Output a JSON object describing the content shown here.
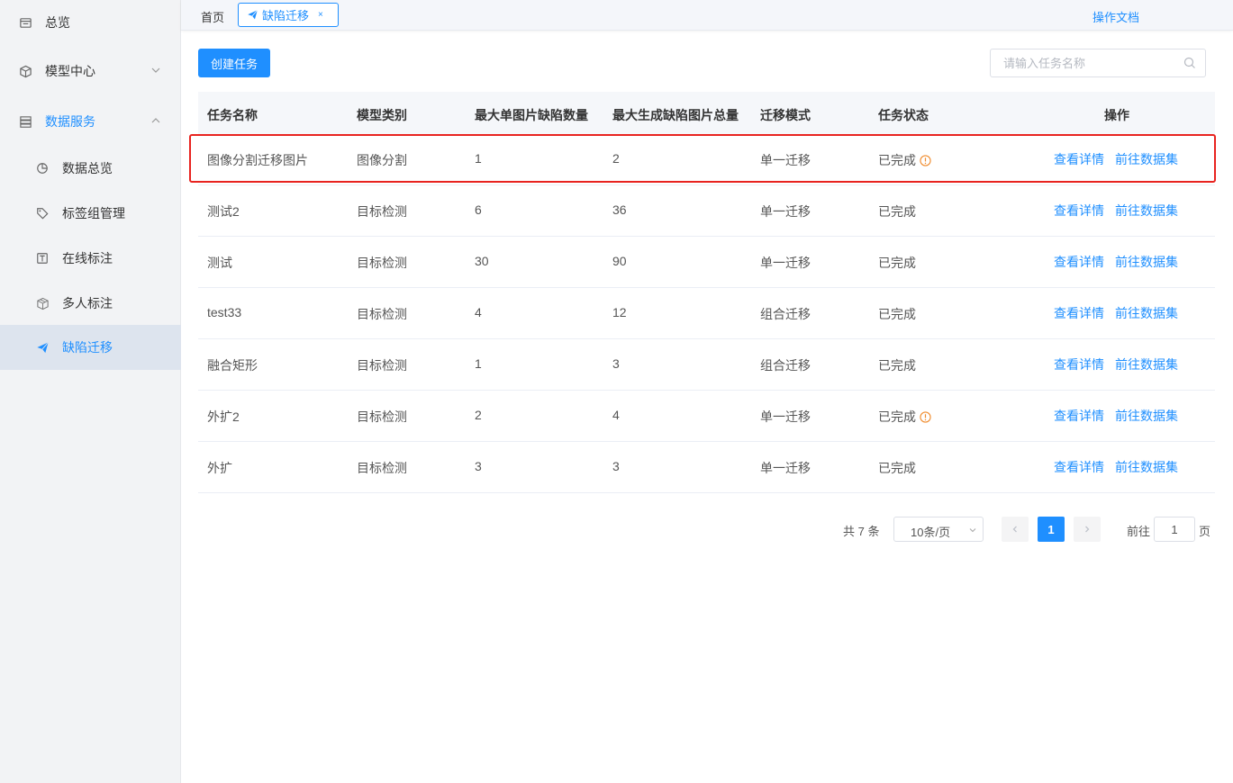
{
  "sidebar": {
    "items": [
      {
        "label": "总览",
        "icon": "overview-icon"
      },
      {
        "label": "模型中心",
        "icon": "cube-icon"
      },
      {
        "label": "数据服务",
        "icon": "storage-icon"
      }
    ],
    "sub_items": [
      {
        "label": "数据总览",
        "icon": "pie-chart-icon"
      },
      {
        "label": "标签组管理",
        "icon": "tag-icon"
      },
      {
        "label": "在线标注",
        "icon": "text-box-icon"
      },
      {
        "label": "多人标注",
        "icon": "boxes-icon"
      },
      {
        "label": "缺陷迁移",
        "icon": "paper-plane-icon"
      }
    ]
  },
  "topbar": {
    "home_tab": "首页",
    "active_tab": "缺陷迁移",
    "close_glyph": "×",
    "doc_link": "操作文档"
  },
  "toolbar": {
    "create_label": "创建任务",
    "search_placeholder": "请输入任务名称"
  },
  "table": {
    "headers": [
      "任务名称",
      "模型类别",
      "最大单图片缺陷数量",
      "最大生成缺陷图片总量",
      "迁移模式",
      "任务状态",
      "操作"
    ],
    "action_view": "查看详情",
    "action_dataset": "前往数据集",
    "rows": [
      {
        "name": "图像分割迁移图片",
        "type": "图像分割",
        "max_single": "1",
        "max_total": "2",
        "mode": "单一迁移",
        "status": "已完成",
        "warning": true
      },
      {
        "name": "测试2",
        "type": "目标检测",
        "max_single": "6",
        "max_total": "36",
        "mode": "单一迁移",
        "status": "已完成",
        "warning": false
      },
      {
        "name": "测试",
        "type": "目标检测",
        "max_single": "30",
        "max_total": "90",
        "mode": "单一迁移",
        "status": "已完成",
        "warning": false
      },
      {
        "name": "test33",
        "type": "目标检测",
        "max_single": "4",
        "max_total": "12",
        "mode": "组合迁移",
        "status": "已完成",
        "warning": false
      },
      {
        "name": "融合矩形",
        "type": "目标检测",
        "max_single": "1",
        "max_total": "3",
        "mode": "组合迁移",
        "status": "已完成",
        "warning": false
      },
      {
        "name": "外扩2",
        "type": "目标检测",
        "max_single": "2",
        "max_total": "4",
        "mode": "单一迁移",
        "status": "已完成",
        "warning": true
      },
      {
        "name": "外扩",
        "type": "目标检测",
        "max_single": "3",
        "max_total": "3",
        "mode": "单一迁移",
        "status": "已完成",
        "warning": false
      }
    ]
  },
  "pagination": {
    "total_text": "共 7 条",
    "page_size": "10条/页",
    "current_page": "1",
    "goto_label": "前往",
    "goto_value": "1",
    "page_suffix": "页"
  },
  "colors": {
    "accent": "#1f8fff",
    "highlight_border": "#e8231f",
    "warning": "#f08c2e"
  }
}
